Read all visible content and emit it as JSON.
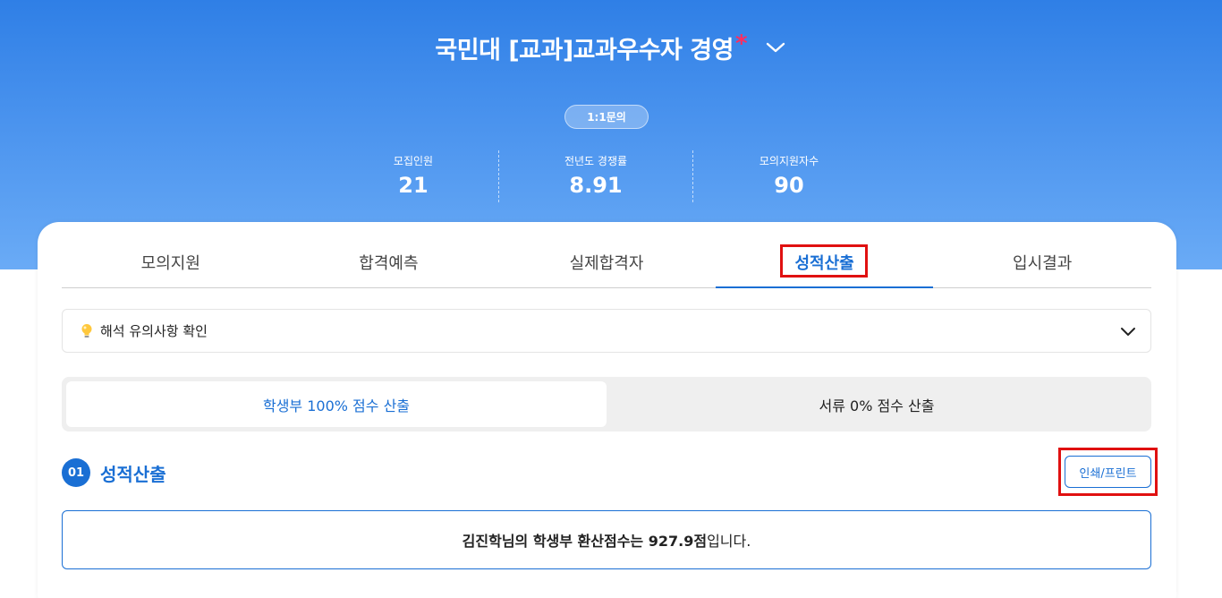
{
  "header": {
    "title": "국민대 [교과]교과우수자 경영",
    "required_mark": "*",
    "inquiry_button": "1:1문의"
  },
  "stats": [
    {
      "label": "모집인원",
      "value": "21"
    },
    {
      "label": "전년도 경쟁률",
      "value": "8.91"
    },
    {
      "label": "모의지원자수",
      "value": "90"
    }
  ],
  "tabs": [
    {
      "label": "모의지원"
    },
    {
      "label": "합격예측"
    },
    {
      "label": "실제합격자"
    },
    {
      "label": "성적산출",
      "active": true
    },
    {
      "label": "입시결과"
    }
  ],
  "notice": {
    "icon": "lightbulb-icon",
    "text": "해석 유의사항 확인"
  },
  "segments": {
    "left": "학생부 100% 점수 산출",
    "right": "서류 0% 점수 산출"
  },
  "section": {
    "number": "01",
    "title": "성적산출",
    "print_button": "인쇄/프린트"
  },
  "result": {
    "prefix": "김진학님의 학생부 환산점수는 ",
    "score": "927.9점",
    "suffix": "입니다."
  },
  "colors": {
    "accent": "#1a6fd4",
    "hero_top": "#2f7fe6",
    "hero_bottom": "#6aabf6",
    "highlight_box": "#e01010",
    "required_mark": "#ff2e5f"
  }
}
